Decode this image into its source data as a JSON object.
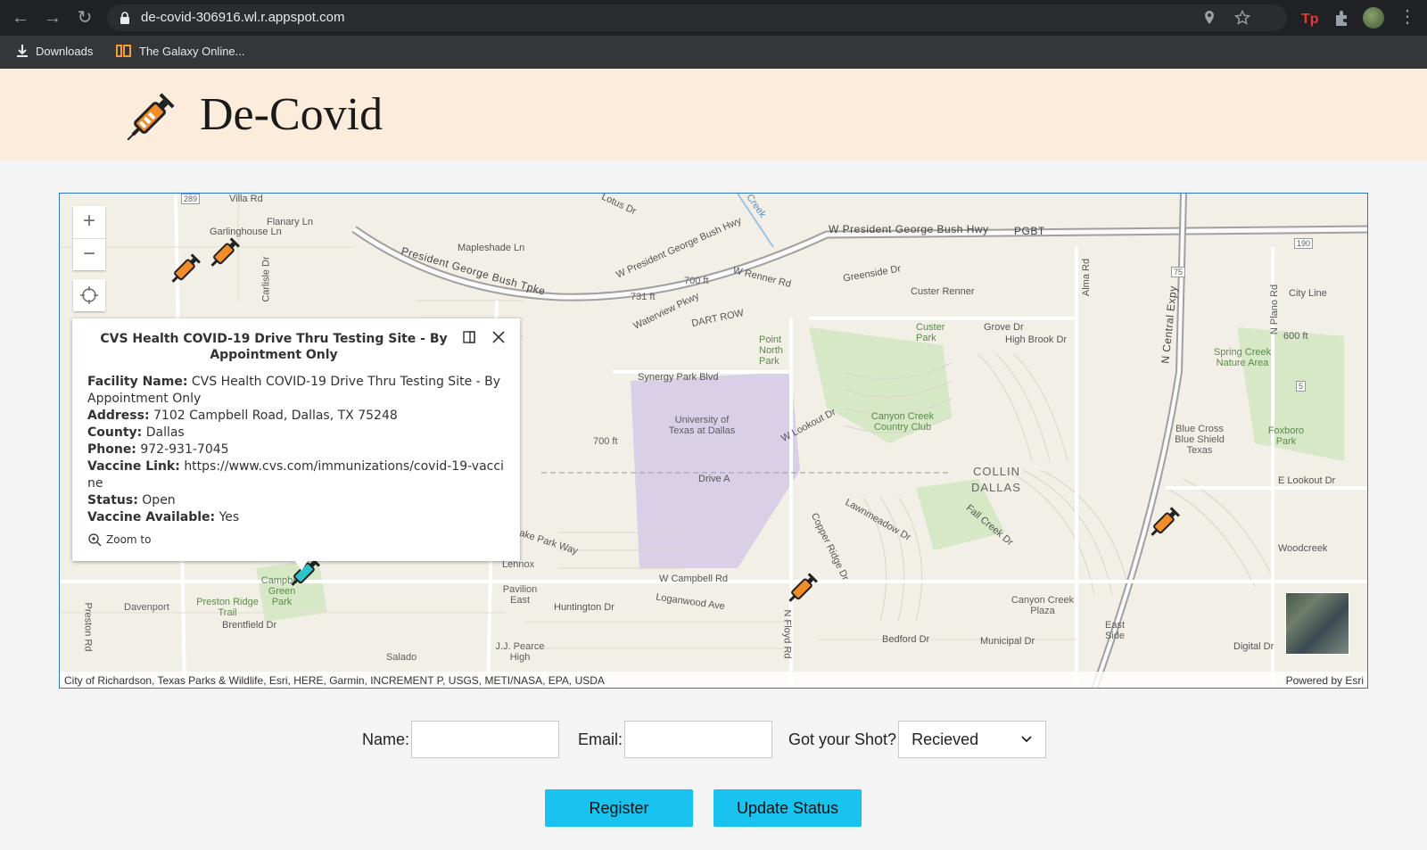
{
  "browser": {
    "url": "de-covid-306916.wl.r.appspot.com",
    "bookmarks": [
      {
        "label": "Downloads",
        "icon": "download-icon"
      },
      {
        "label": "The Galaxy Online...",
        "icon": "galaxy-icon"
      }
    ]
  },
  "header": {
    "title": "De-Covid",
    "logo_icon": "syringe-icon"
  },
  "map": {
    "labels": [
      {
        "text": "Villa Rd"
      },
      {
        "text": "Flanary Ln"
      },
      {
        "text": "Garlinghouse Ln"
      },
      {
        "text": "Mapleshade Ln"
      },
      {
        "text": "Lotus Dr"
      },
      {
        "text": "Creek"
      },
      {
        "text": "W President George Bush Hwy"
      },
      {
        "text": "PGBT"
      },
      {
        "text": "President George Bush Tpke"
      },
      {
        "text": "W President George Bush Hwy"
      },
      {
        "text": "W Renner Rd"
      },
      {
        "text": "Greenside Dr"
      },
      {
        "text": "Custer Renner"
      },
      {
        "text": "Alma Rd"
      },
      {
        "text": "N Central Expy"
      },
      {
        "text": "City Line"
      },
      {
        "text": "N Plano Rd"
      },
      {
        "text": "Waterview Pkwy"
      },
      {
        "text": "700 ft"
      },
      {
        "text": "731 ft"
      },
      {
        "text": "DART ROW"
      },
      {
        "text": "Point North Park"
      },
      {
        "text": "Custer Park"
      },
      {
        "text": "Grove Dr"
      },
      {
        "text": "High Brook Dr"
      },
      {
        "text": "Spring Creek Nature Area"
      },
      {
        "text": "600 ft"
      },
      {
        "text": "Synergy Park Blvd"
      },
      {
        "text": "University of Texas at Dallas"
      },
      {
        "text": "W Lookout Dr"
      },
      {
        "text": "Canyon Creek Country Club"
      },
      {
        "text": "700 ft"
      },
      {
        "text": "COLLIN"
      },
      {
        "text": "DALLAS"
      },
      {
        "text": "Drive A"
      },
      {
        "text": "Blue Cross Blue Shield Texas"
      },
      {
        "text": "Foxboro Park"
      },
      {
        "text": "E Lookout Dr"
      },
      {
        "text": "Lawnmeadow Dr"
      },
      {
        "text": "Copper Ridge Dr"
      },
      {
        "text": "Fall Creek Dr"
      },
      {
        "text": "Woodcreek"
      },
      {
        "text": "Lake Park Way"
      },
      {
        "text": "Lennox"
      },
      {
        "text": "W Campbell Rd"
      },
      {
        "text": "Pavilion East"
      },
      {
        "text": "Huntington Dr"
      },
      {
        "text": "Loganwood Ave"
      },
      {
        "text": "Canyon Creek Plaza"
      },
      {
        "text": "Davenport"
      },
      {
        "text": "Preston Ridge Trail"
      },
      {
        "text": "Campbell Green Park"
      },
      {
        "text": "Brentfield Dr"
      },
      {
        "text": "Bedford Dr"
      },
      {
        "text": "Municipal Dr"
      },
      {
        "text": "East Side"
      },
      {
        "text": "Digital Dr"
      },
      {
        "text": "J.J. Pearce High"
      },
      {
        "text": "Salado"
      },
      {
        "text": "Preston Rd"
      },
      {
        "text": "N Floyd Rd"
      },
      {
        "text": "Carlisle Dr"
      },
      {
        "text": "289"
      },
      {
        "text": "75"
      },
      {
        "text": "190"
      },
      {
        "text": "5"
      }
    ],
    "controls": {
      "zoom_in": "+",
      "zoom_out": "−"
    },
    "attribution": "City of Richardson, Texas Parks & Wildlife, Esri, HERE, Garmin, INCREMENT P, USGS, METI/NASA, EPA, USDA",
    "powered_by": "Powered by Esri",
    "popup": {
      "title": "CVS Health COVID-19 Drive Thru Testing Site - By Appointment Only",
      "fields": [
        {
          "label": "Facility Name:",
          "value": "CVS Health COVID-19 Drive Thru Testing Site - By Appointment Only"
        },
        {
          "label": "Address:",
          "value": "7102 Campbell Road, Dallas, TX 75248"
        },
        {
          "label": "County:",
          "value": "Dallas"
        },
        {
          "label": "Phone:",
          "value": "972-931-7045"
        },
        {
          "label": "Vaccine Link:",
          "value": "https://www.cvs.com/immunizations/covid-19-vaccine"
        },
        {
          "label": "Status:",
          "value": "Open"
        },
        {
          "label": "Vaccine Available:",
          "value": "Yes"
        }
      ],
      "zoom_to": "Zoom to"
    },
    "colors": {
      "marker_orange": "#f08c2a",
      "marker_selected": "#2bc3c8",
      "park": "#d6e8c6",
      "campus": "#d9cfe6"
    }
  },
  "form": {
    "name_label": "Name:",
    "name_value": "",
    "email_label": "Email:",
    "email_value": "",
    "shot_label": "Got your Shot?",
    "shot_selected": "Recieved"
  },
  "buttons": {
    "register": "Register",
    "update_status": "Update Status"
  },
  "colors": {
    "header_bg": "#fcecdc",
    "button_bg": "#19c3ef",
    "map_border": "#2f76c6"
  }
}
